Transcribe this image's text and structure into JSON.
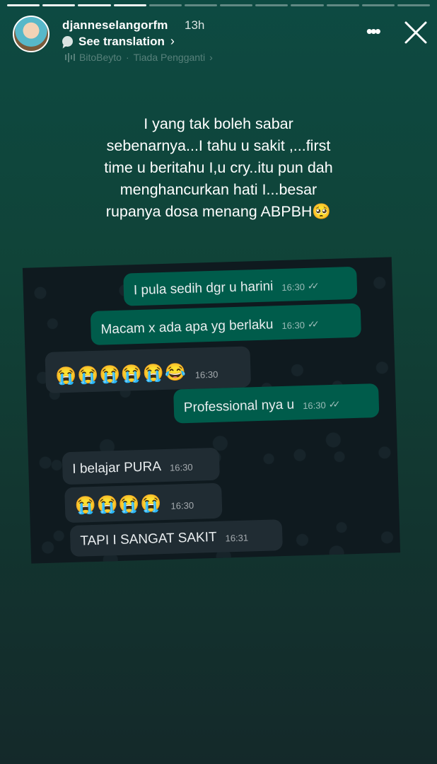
{
  "story": {
    "segments_total": 12,
    "segments_done": 4,
    "username": "djanneselangorfm",
    "time_ago": "13h",
    "translate_label": "See translation",
    "music": {
      "artist": "BitoBeyto",
      "separator": "·",
      "song": "Tiada Pengganti"
    }
  },
  "caption": {
    "lines": [
      "I yang tak boleh sabar",
      "sebenarnya...I tahu u sakit ,...first",
      "time u beritahu I,u cry..itu pun dah",
      "menghancurkan hati I...besar",
      "rupanya dosa menang ABPBH🥺"
    ]
  },
  "chat": {
    "messages": [
      {
        "dir": "out",
        "text": "I pula sedih dgr u harini",
        "time": "16:30",
        "read": true
      },
      {
        "dir": "out",
        "text": "Macam x ada apa yg berlaku",
        "time": "16:30",
        "read": true
      },
      {
        "dir": "in",
        "text": "😭😭😭😭😭😂",
        "time": "16:30",
        "read": false
      },
      {
        "dir": "out",
        "text": "Professional nya u",
        "time": "16:30",
        "read": true
      },
      {
        "dir": "in",
        "text": "I belajar PURA",
        "time": "16:30",
        "read": false
      },
      {
        "dir": "in",
        "text": "😭😭😭😭",
        "time": "16:30",
        "read": false
      },
      {
        "dir": "in",
        "text": "TAPI I SANGAT SAKIT",
        "time": "16:31",
        "read": false
      }
    ]
  },
  "colors": {
    "outgoing_bubble": "#005c4b",
    "incoming_bubble": "#202c33",
    "chat_background": "#0f1a1f"
  },
  "icons": {
    "more": "more-icon",
    "close": "close-icon",
    "translate": "speech-bubble-icon",
    "music": "sound-bars-icon"
  }
}
